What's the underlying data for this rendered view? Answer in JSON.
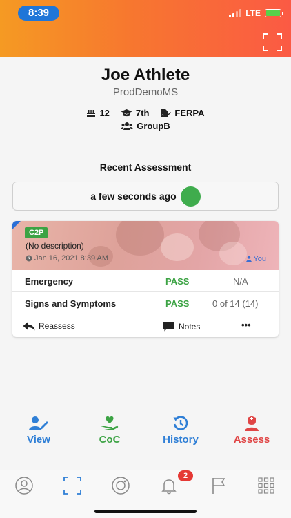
{
  "status_bar": {
    "time": "8:39",
    "network": "LTE"
  },
  "profile": {
    "name": "Joe Athlete",
    "school": "ProdDemoMS",
    "tags": [
      {
        "icon": "cake-icon",
        "text": "12"
      },
      {
        "icon": "graduation-cap-icon",
        "text": "7th"
      },
      {
        "icon": "file-signature-icon",
        "text": "FERPA"
      },
      {
        "icon": "users-icon",
        "text": "GroupB"
      }
    ]
  },
  "recent": {
    "title": "Recent Assessment",
    "time_ago": "a few seconds ago",
    "status_color": "#3fac4d"
  },
  "card": {
    "badge": "C2P",
    "description": "(No description)",
    "date": "Jan 16, 2021 8:39 AM",
    "owner": "You",
    "rows": [
      {
        "label": "Emergency",
        "result": "PASS",
        "detail": "N/A"
      },
      {
        "label": "Signs and Symptoms",
        "result": "PASS",
        "detail": "0 of 14 (14)"
      }
    ],
    "actions": {
      "reassess": "Reassess",
      "notes": "Notes",
      "more": "•••"
    }
  },
  "bottom_actions": [
    {
      "label": "View",
      "color": "#2f7fd6"
    },
    {
      "label": "CoC",
      "color": "#3ca344"
    },
    {
      "label": "History",
      "color": "#2f7fd6"
    },
    {
      "label": "Assess",
      "color": "#e04545"
    }
  ],
  "tabbar": {
    "notification_count": "2"
  }
}
